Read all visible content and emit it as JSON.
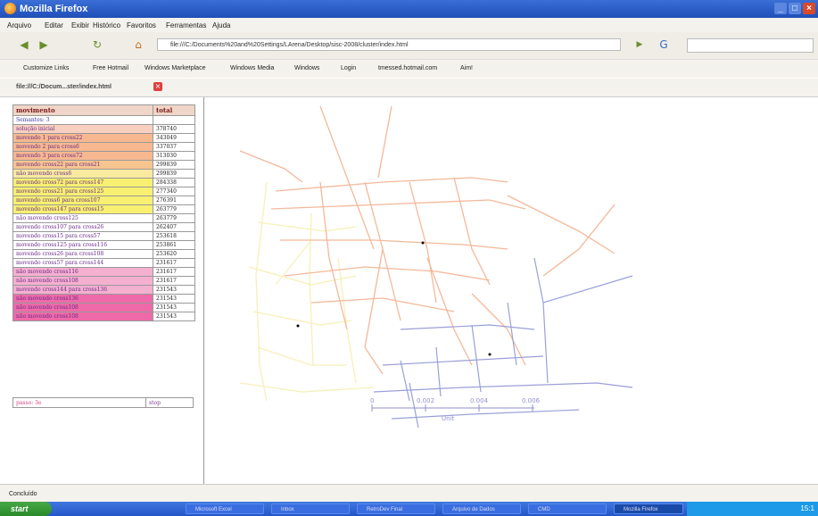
{
  "window": {
    "title": "Mozilla Firefox"
  },
  "menu": [
    "Arquivo",
    "Editar",
    "Exibir",
    "Histórico",
    "Favoritos",
    "Ferramentas",
    "Ajuda"
  ],
  "navigation": {
    "url": "file:///C:/Documents%20and%20Settings/LArena/Desktop/sisc-2008/cluster/index.html"
  },
  "bookmarks": [
    "Customize Links",
    "Free Hotmail",
    "Windows Marketplace",
    "Windows Media",
    "Windows",
    "Login",
    "tmessed.hotmail.com",
    "Aim!"
  ],
  "tab": {
    "title": "file:///C:/Docum...ster/index.html"
  },
  "table": {
    "headers": [
      "movimento",
      "total"
    ],
    "subheader": "Semantes: 3",
    "rows": [
      {
        "label": "solução inicial",
        "total": "378740",
        "color": "#f9d0c0"
      },
      {
        "label": "movendo 1 para cross22",
        "total": "343049",
        "color": "#f7b890"
      },
      {
        "label": "movendo 2 para cross6",
        "total": "337037",
        "color": "#f7b890"
      },
      {
        "label": "movendo 3 para cross72",
        "total": "313030",
        "color": "#f7b890"
      },
      {
        "label": "movendo cross22 para cross21",
        "total": "299839",
        "color": "#f7c590"
      },
      {
        "label": "não movendo cross6",
        "total": "299839",
        "color": "#f9eaa0"
      },
      {
        "label": "movendo cross72 para cross147",
        "total": "284338",
        "color": "#f7f070"
      },
      {
        "label": "movendo cross21 para cross125",
        "total": "277340",
        "color": "#f7f070"
      },
      {
        "label": "movendo cross6 para cross107",
        "total": "276391",
        "color": "#f7f070"
      },
      {
        "label": "movendo cross147 para cross15",
        "total": "263779",
        "color": "#f7f070"
      },
      {
        "label": "não movendo cross125",
        "total": "263779",
        "color": "#fff"
      },
      {
        "label": "movendo cross107 para cross26",
        "total": "262407",
        "color": "#fff"
      },
      {
        "label": "movendo cross15 para cross57",
        "total": "253618",
        "color": "#fff"
      },
      {
        "label": "movendo cross125 para cross116",
        "total": "253861",
        "color": "#fff"
      },
      {
        "label": "movendo cross26 para cross108",
        "total": "253620",
        "color": "#fff"
      },
      {
        "label": "movendo cross57 para cross144",
        "total": "231617",
        "color": "#fff"
      },
      {
        "label": "não movendo cross116",
        "total": "231617",
        "color": "#f5b0d0"
      },
      {
        "label": "não movendo cross108",
        "total": "231617",
        "color": "#f5b0d0"
      },
      {
        "label": "movendo cross144 para cross136",
        "total": "231543",
        "color": "#f5b0d0"
      },
      {
        "label": "não movendo cross136",
        "total": "231543",
        "color": "#ee6aa8"
      },
      {
        "label": "não movendo cross108",
        "total": "231543",
        "color": "#ee6aa8"
      },
      {
        "label": "não movendo cross108",
        "total": "231543",
        "color": "#ee6aa8"
      }
    ],
    "controls": {
      "left": "passo: 3e",
      "right": "stop"
    }
  },
  "map": {
    "scale_labels": [
      "0",
      "0.002",
      "0.004",
      "0.006"
    ],
    "scale_unit": "Unit"
  },
  "status": {
    "text": "Concluído"
  },
  "taskbar": {
    "start": "start",
    "tasks": [
      "Microsoft Excel",
      "Inbox",
      "RetroDev Final",
      "Arquivo de Dados",
      "CMD",
      "Mozilla Firefox"
    ],
    "tray": "15:1"
  }
}
